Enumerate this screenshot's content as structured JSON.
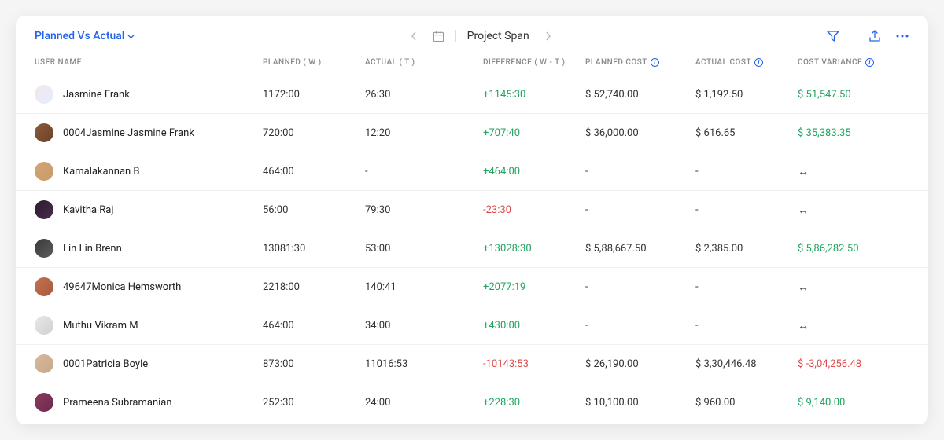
{
  "header": {
    "dropdown_label": "Planned Vs Actual",
    "span_label": "Project Span"
  },
  "columns": {
    "user": "USER NAME",
    "planned": "PLANNED ( W )",
    "actual": "ACTUAL ( T )",
    "difference": "DIFFERENCE ( W - T )",
    "planned_cost": "PLANNED COST",
    "actual_cost": "ACTUAL COST",
    "variance": "COST VARIANCE"
  },
  "rows": [
    {
      "name": "Jasmine Frank",
      "planned": "1172:00",
      "actual": "26:30",
      "diff": "+1145:30",
      "diff_sign": "pos",
      "pcost": "$ 52,740.00",
      "acost": "$ 1,192.50",
      "var": "$ 51,547.50",
      "var_sign": "pos"
    },
    {
      "name": "0004Jasmine Jasmine Frank",
      "planned": "720:00",
      "actual": "12:20",
      "diff": "+707:40",
      "diff_sign": "pos",
      "pcost": "$ 36,000.00",
      "acost": "$ 616.65",
      "var": "$ 35,383.35",
      "var_sign": "pos"
    },
    {
      "name": "Kamalakannan B",
      "planned": "464:00",
      "actual": "-",
      "diff": "+464:00",
      "diff_sign": "pos",
      "pcost": "-",
      "acost": "-",
      "var": "↔",
      "var_sign": "neutral"
    },
    {
      "name": "Kavitha Raj",
      "planned": "56:00",
      "actual": "79:30",
      "diff": "-23:30",
      "diff_sign": "neg",
      "pcost": "-",
      "acost": "-",
      "var": "↔",
      "var_sign": "neutral"
    },
    {
      "name": "Lin Lin Brenn",
      "planned": "13081:30",
      "actual": "53:00",
      "diff": "+13028:30",
      "diff_sign": "pos",
      "pcost": "$ 5,88,667.50",
      "acost": "$ 2,385.00",
      "var": "$ 5,86,282.50",
      "var_sign": "pos"
    },
    {
      "name": "49647Monica Hemsworth",
      "planned": "2218:00",
      "actual": "140:41",
      "diff": "+2077:19",
      "diff_sign": "pos",
      "pcost": "-",
      "acost": "-",
      "var": "↔",
      "var_sign": "neutral"
    },
    {
      "name": "Muthu Vikram M",
      "planned": "464:00",
      "actual": "34:00",
      "diff": "+430:00",
      "diff_sign": "pos",
      "pcost": "-",
      "acost": "-",
      "var": "↔",
      "var_sign": "neutral"
    },
    {
      "name": "0001Patricia Boyle",
      "planned": "873:00",
      "actual": "11016:53",
      "diff": "-10143:53",
      "diff_sign": "neg",
      "pcost": "$ 26,190.00",
      "acost": "$ 3,30,446.48",
      "var": "$ -3,04,256.48",
      "var_sign": "neg"
    },
    {
      "name": "Prameena Subramanian",
      "planned": "252:30",
      "actual": "24:00",
      "diff": "+228:30",
      "diff_sign": "pos",
      "pcost": "$ 10,100.00",
      "acost": "$ 960.00",
      "var": "$ 9,140.00",
      "var_sign": "pos"
    }
  ]
}
